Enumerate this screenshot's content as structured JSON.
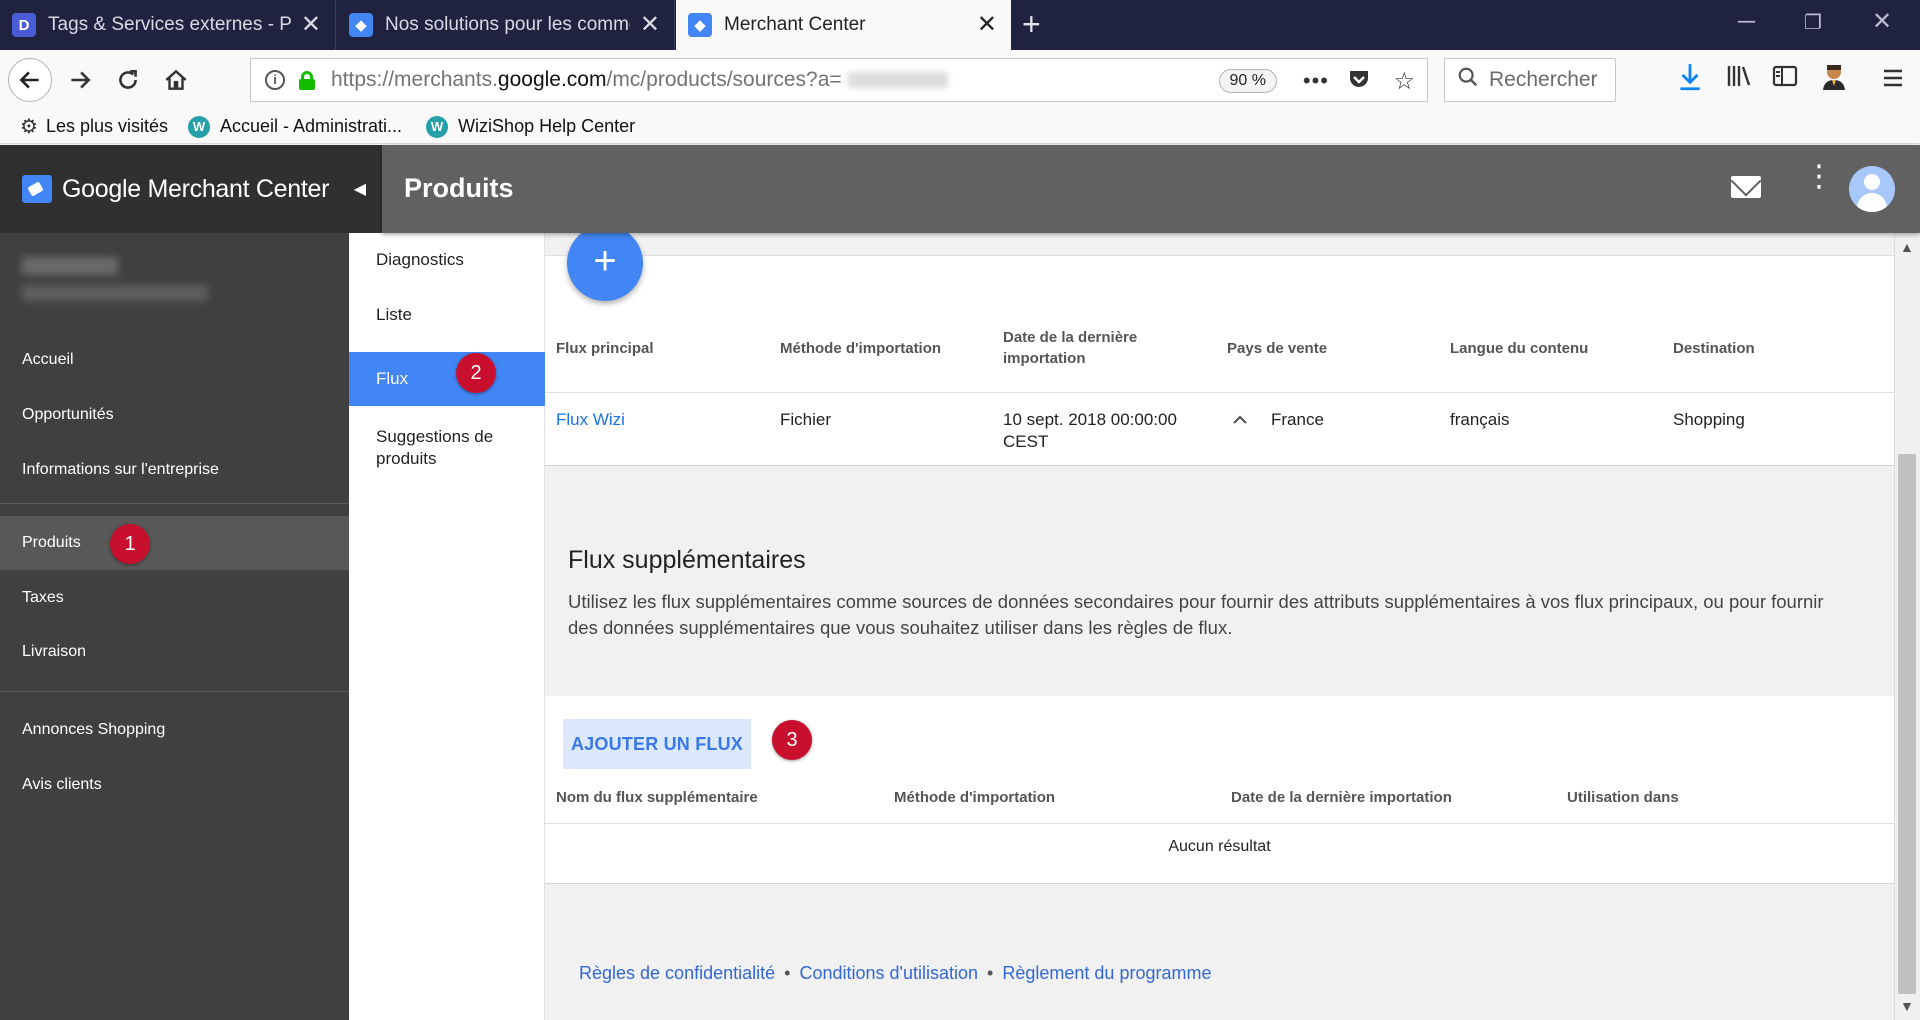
{
  "browser": {
    "tabs": [
      {
        "title": "Tags & Services externes - Préfé",
        "favicon": "D"
      },
      {
        "title": "Nos solutions pour les commerc",
        "favicon": "tag"
      },
      {
        "title": "Merchant Center",
        "favicon": "tag",
        "active": true
      }
    ],
    "new_tab": "+",
    "window_controls": [
      "minimize-icon",
      "restore-icon",
      "close-icon"
    ],
    "url_prefix": "https://merchants.",
    "url_domain": "google.com",
    "url_suffix": "/mc/products/sources?a=",
    "zoom": "90 %",
    "search_placeholder": "Rechercher",
    "bookmarks": [
      {
        "label": "Les plus visités",
        "icon": "gear-icon"
      },
      {
        "label": "Accueil - Administrati...",
        "icon": "wizi-icon"
      },
      {
        "label": "WiziShop Help Center",
        "icon": "wizi-icon"
      }
    ]
  },
  "app": {
    "brand": "Google Merchant Center",
    "page_title": "Produits"
  },
  "sidebar": {
    "items": [
      {
        "label": "Accueil"
      },
      {
        "label": "Opportunités"
      },
      {
        "label": "Informations sur l'entreprise"
      },
      {
        "label": "Produits",
        "selected": true
      },
      {
        "label": "Taxes"
      },
      {
        "label": "Livraison"
      },
      {
        "label": "Annonces Shopping"
      },
      {
        "label": "Avis clients"
      }
    ]
  },
  "subnav": {
    "items": [
      {
        "label": "Diagnostics"
      },
      {
        "label": "Liste"
      },
      {
        "label": "Flux",
        "active": true
      },
      {
        "label": "Suggestions de produits"
      }
    ]
  },
  "badges": [
    "1",
    "2",
    "3"
  ],
  "primary_feeds": {
    "add_button": "+",
    "headers": [
      "Flux principal",
      "Méthode d'importation",
      "Date de la dernière importation",
      "Pays de vente",
      "Langue du contenu",
      "Destination"
    ],
    "rows": [
      {
        "name": "Flux Wizi",
        "method": "Fichier",
        "date": "10 sept. 2018 00:00:00 CEST",
        "country": "France",
        "language": "français",
        "destination": "Shopping"
      }
    ]
  },
  "supplemental": {
    "title": "Flux supplémentaires",
    "description": "Utilisez les flux supplémentaires comme sources de données secondaires pour fournir des attributs supplémentaires à vos flux principaux, ou pour fournir des données supplémentaires que vous souhaitez utiliser dans les règles de flux.",
    "add_button": "AJOUTER UN FLUX",
    "headers": [
      "Nom du flux supplémentaire",
      "Méthode d'importation",
      "Date de la dernière importation",
      "Utilisation dans"
    ],
    "empty": "Aucun résultat"
  },
  "footer": {
    "links": [
      "Règles de confidentialité",
      "Conditions d'utilisation",
      "Règlement du programme"
    ],
    "separator": "•"
  },
  "colors": {
    "accent": "#4285f4",
    "badge": "#c8102e",
    "sidebar": "#404040",
    "appbar": "#616161"
  }
}
